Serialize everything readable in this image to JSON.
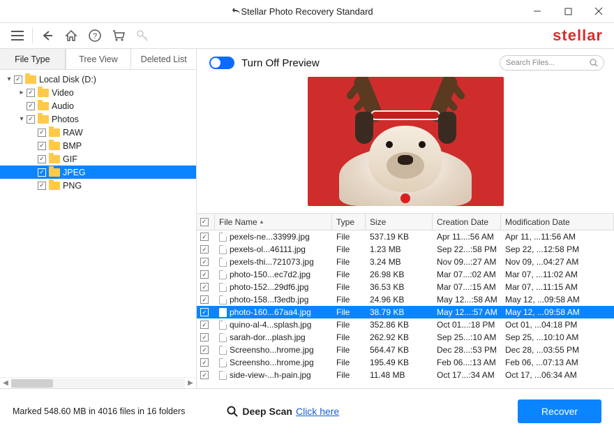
{
  "window": {
    "title": "Stellar Photo Recovery Standard"
  },
  "brand": "stellar",
  "sidebar": {
    "tabs": [
      "File Type",
      "Tree View",
      "Deleted List"
    ],
    "active_tab": 0,
    "root": {
      "label": "Local Disk (D:)",
      "children": [
        {
          "label": "Video",
          "expandable": true,
          "expanded": false
        },
        {
          "label": "Audio",
          "expandable": false
        },
        {
          "label": "Photos",
          "expandable": true,
          "expanded": true,
          "children": [
            {
              "label": "RAW"
            },
            {
              "label": "BMP"
            },
            {
              "label": "GIF"
            },
            {
              "label": "JPEG",
              "selected": true
            },
            {
              "label": "PNG"
            }
          ]
        }
      ]
    }
  },
  "preview": {
    "toggle_label": "Turn Off Preview"
  },
  "search": {
    "placeholder": "Search Files..."
  },
  "table": {
    "columns": [
      "File Name",
      "Type",
      "Size",
      "Creation Date",
      "Modification Date"
    ],
    "rows": [
      {
        "name": "pexels-ne...33999.jpg",
        "type": "File",
        "size": "537.19 KB",
        "cd": "Apr 11...:56 AM",
        "md": "Apr 11, ...11:56 AM"
      },
      {
        "name": "pexels-ol...46111.jpg",
        "type": "File",
        "size": "1.23 MB",
        "cd": "Sep 22...:58 PM",
        "md": "Sep 22, ...12:58 PM"
      },
      {
        "name": "pexels-thi...721073.jpg",
        "type": "File",
        "size": "3.24 MB",
        "cd": "Nov 09...:27 AM",
        "md": "Nov 09, ...04:27 AM"
      },
      {
        "name": "photo-150...ec7d2.jpg",
        "type": "File",
        "size": "26.98 KB",
        "cd": "Mar 07...:02 AM",
        "md": "Mar 07, ...11:02 AM"
      },
      {
        "name": "photo-152...29df6.jpg",
        "type": "File",
        "size": "36.53 KB",
        "cd": "Mar 07...:15 AM",
        "md": "Mar 07, ...11:15 AM"
      },
      {
        "name": "photo-158...f3edb.jpg",
        "type": "File",
        "size": "24.96 KB",
        "cd": "May 12...:58 AM",
        "md": "May 12, ...09:58 AM"
      },
      {
        "name": "photo-160...67aa4.jpg",
        "type": "File",
        "size": "38.79 KB",
        "cd": "May 12...:57 AM",
        "md": "May 12, ...09:58 AM",
        "selected": true
      },
      {
        "name": "quino-al-4...splash.jpg",
        "type": "File",
        "size": "352.86 KB",
        "cd": "Oct 01...:18 PM",
        "md": "Oct 01, ...04:18 PM"
      },
      {
        "name": "sarah-dor...plash.jpg",
        "type": "File",
        "size": "262.92 KB",
        "cd": "Sep 25...:10 AM",
        "md": "Sep 25, ...10:10 AM"
      },
      {
        "name": "Screensho...hrome.jpg",
        "type": "File",
        "size": "564.47 KB",
        "cd": "Dec 28...:53 PM",
        "md": "Dec 28, ...03:55 PM"
      },
      {
        "name": "Screensho...hrome.jpg",
        "type": "File",
        "size": "195.49 KB",
        "cd": "Feb 06...:13 AM",
        "md": "Feb 06, ...07:13 AM"
      },
      {
        "name": "side-view-...h-pain.jpg",
        "type": "File",
        "size": "11.48 MB",
        "cd": "Oct 17...:34 AM",
        "md": "Oct 17, ...06:34 AM"
      }
    ]
  },
  "footer": {
    "status": "Marked 548.60 MB in 4016 files in 16 folders",
    "deep_label": "Deep Scan",
    "deep_link": "Click here",
    "recover": "Recover"
  }
}
